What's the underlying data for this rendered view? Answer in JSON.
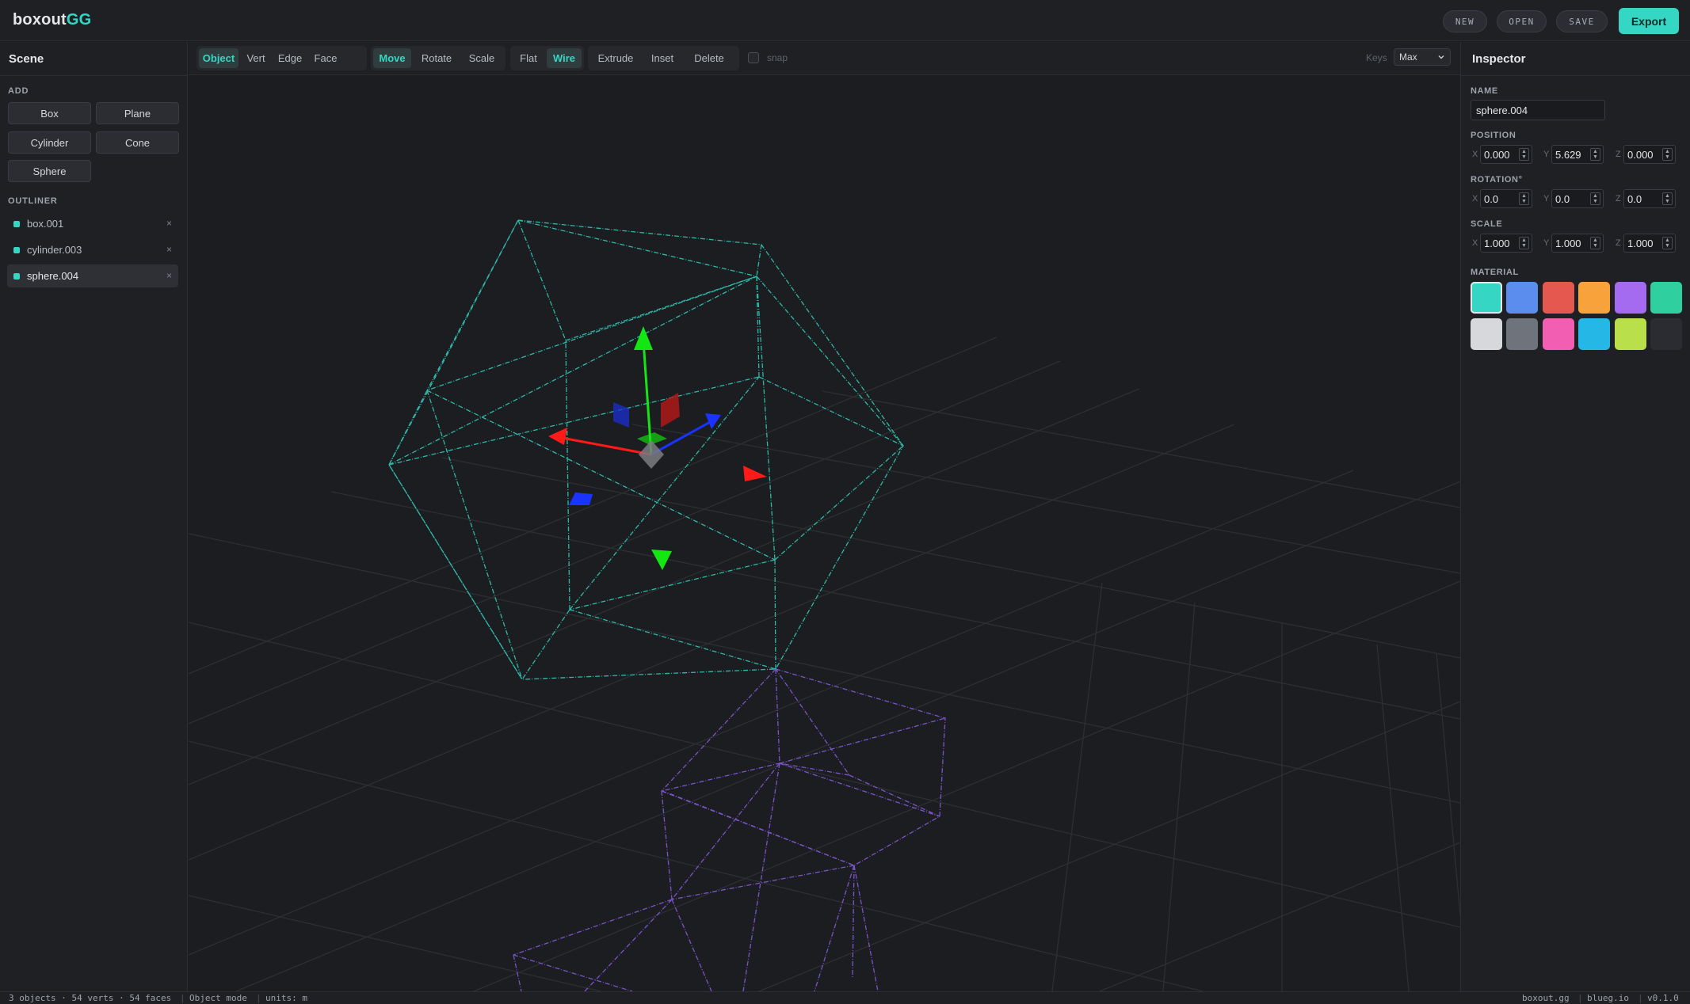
{
  "app": {
    "logo_a": "boxout",
    "logo_b": "GG",
    "new_label": "NEW",
    "open_label": "OPEN",
    "save_label": "SAVE",
    "export_label": "Export"
  },
  "scene": {
    "title": "Scene",
    "add_label": "ADD",
    "add_buttons": [
      "Box",
      "Plane",
      "Cylinder",
      "Cone",
      "Sphere"
    ],
    "outliner_label": "OUTLINER",
    "items": [
      {
        "name": "box.001",
        "remove": "×"
      },
      {
        "name": "cylinder.003",
        "remove": "×"
      },
      {
        "name": "sphere.004",
        "remove": "×",
        "selected": true
      }
    ]
  },
  "toolbar": {
    "modes": [
      "Object",
      "Vert",
      "Edge",
      "Face"
    ],
    "active_mode": "Object",
    "transforms": [
      "Move",
      "Rotate",
      "Scale"
    ],
    "active_transform": "Move",
    "shading": [
      "Flat",
      "Wire"
    ],
    "active_shading": "Wire",
    "ops": [
      "Extrude",
      "Inset",
      "Delete"
    ],
    "snap_label": "snap",
    "keys_label": "Keys",
    "keys_value": "Max"
  },
  "inspector": {
    "title": "Inspector",
    "name_label": "NAME",
    "name_value": "sphere.004",
    "position_label": "POSITION",
    "position": {
      "x": "0.000",
      "y": "5.629",
      "z": "0.000"
    },
    "rotation_label": "ROTATION°",
    "rotation": {
      "x": "0.0",
      "y": "0.0",
      "z": "0.0"
    },
    "scale_label": "SCALE",
    "scale": {
      "x": "1.000",
      "y": "1.000",
      "z": "1.000"
    },
    "axis_x": "X",
    "axis_y": "Y",
    "axis_z": "Z",
    "material_label": "MATERIAL",
    "material_colors": [
      "#35d6c3",
      "#5b8def",
      "#e5584f",
      "#f8a23b",
      "#a46bf0",
      "#30cf9f",
      "#d6d8dc",
      "#6f737b",
      "#f25fb2",
      "#25b7e6",
      "#b9e04a",
      "#2a2c31"
    ],
    "selected_material": 0
  },
  "status": {
    "counts": "3 objects · 54 verts · 54 faces",
    "mode": "Object mode",
    "units": "units: m",
    "right1": "boxout.gg",
    "right2": "blueg.io",
    "version": "v0.1.0"
  },
  "colors": {
    "accent": "#35d6c3",
    "wire_sphere": "#2fb8a9",
    "wire_cylinder": "#7b54c9",
    "gizmo_x": "#ff1a1a",
    "gizmo_y": "#14e614",
    "gizmo_z": "#1a33ff"
  }
}
